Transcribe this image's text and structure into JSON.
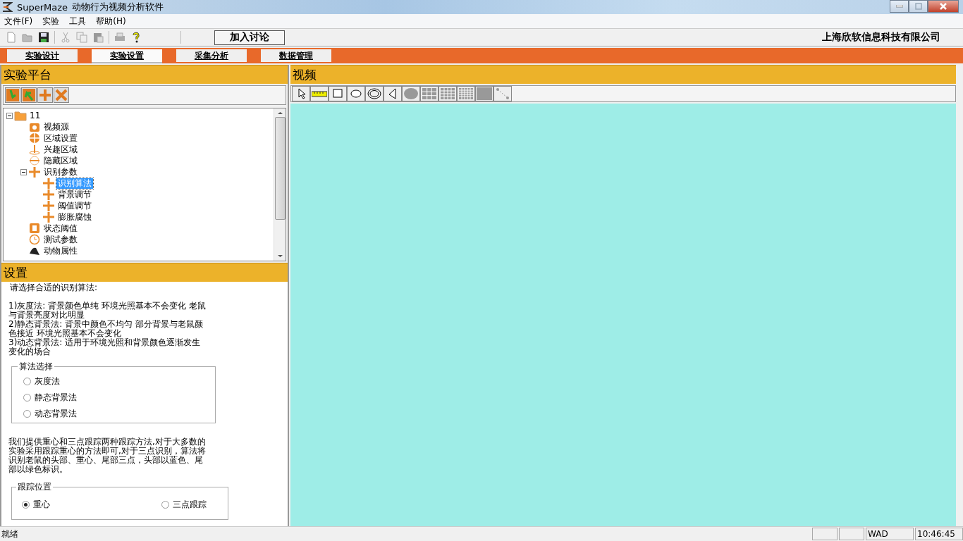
{
  "window": {
    "app_name": "SuperMaze",
    "title": "动物行为视频分析软件"
  },
  "menu": [
    "文件(F)",
    "实验",
    "工具",
    "帮助(H)"
  ],
  "toolbar": {
    "discuss_button": "加入讨论",
    "company": "上海欣软信息科技有限公司"
  },
  "tabs": [
    {
      "label": "实验设计",
      "selected": false
    },
    {
      "label": "实验设置",
      "selected": true
    },
    {
      "label": "采集分析",
      "selected": false
    },
    {
      "label": "数据管理",
      "selected": false
    }
  ],
  "platform": {
    "title": "实验平台",
    "tree": [
      {
        "label": "11",
        "kind": "folder",
        "expanded": true,
        "selected": false,
        "children": [
          {
            "label": "视频源",
            "kind": "camera",
            "selected": false
          },
          {
            "label": "区域设置",
            "kind": "pie",
            "selected": false
          },
          {
            "label": "兴趣区域",
            "kind": "flag",
            "selected": false
          },
          {
            "label": "隐藏区域",
            "kind": "hidden",
            "selected": false
          },
          {
            "label": "识别参数",
            "kind": "cross",
            "expanded": true,
            "selected": false,
            "children": [
              {
                "label": "识别算法",
                "kind": "cross",
                "selected": true
              },
              {
                "label": "背景调节",
                "kind": "cross",
                "selected": false
              },
              {
                "label": "阈值调节",
                "kind": "cross",
                "selected": false
              },
              {
                "label": "膨胀腐蚀",
                "kind": "cross",
                "selected": false
              }
            ]
          },
          {
            "label": "状态阈值",
            "kind": "counter",
            "selected": false
          },
          {
            "label": "测试参数",
            "kind": "clock",
            "selected": false
          },
          {
            "label": "动物属性",
            "kind": "animal",
            "selected": false
          }
        ]
      }
    ]
  },
  "settings": {
    "title": "设置",
    "intro": "请选择合适的识别算法:",
    "methods": [
      "1)灰度法: 背景颜色单纯 环境光照基本不会变化 老鼠与背景亮度对比明显",
      "2)静态背景法: 背景中颜色不均匀 部分背景与老鼠颜色接近 环境光照基本不会变化",
      "3)动态背景法: 适用于环境光照和背景颜色逐渐发生变化的场合"
    ],
    "algorithm_group": {
      "title": "算法选择",
      "options": [
        {
          "label": "灰度法",
          "selected": false
        },
        {
          "label": "静态背景法",
          "selected": false
        },
        {
          "label": "动态背景法",
          "selected": false
        }
      ]
    },
    "tracking_note": "我们提供重心和三点跟踪两种跟踪方法,对于大多数的实验采用跟踪重心的方法即可,对于三点识别，算法将识别老鼠的头部、重心、尾部三点，头部以蓝色、尾部以绿色标识。",
    "tracking_group": {
      "title": "跟踪位置",
      "options": [
        {
          "label": "重心",
          "selected": true
        },
        {
          "label": "三点跟踪",
          "selected": false
        }
      ]
    }
  },
  "video": {
    "title": "视频",
    "tools": [
      {
        "kind": "pointer"
      },
      {
        "kind": "ruler"
      },
      {
        "kind": "rect"
      },
      {
        "kind": "ellipse"
      },
      {
        "kind": "ring"
      },
      {
        "kind": "polygon"
      },
      {
        "kind": "disc"
      },
      {
        "kind": "grid3"
      },
      {
        "kind": "grid4"
      },
      {
        "kind": "grid5"
      },
      {
        "kind": "fill"
      },
      {
        "kind": "line"
      }
    ]
  },
  "status_bar": {
    "message": "就绪",
    "mode": "WAD",
    "time": "10:46:45"
  }
}
